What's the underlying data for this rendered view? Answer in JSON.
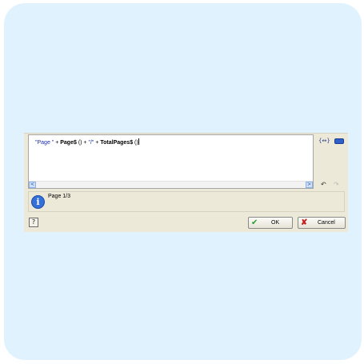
{
  "editor": {
    "expression": {
      "part1": "\"Page \"",
      "part2": " + ",
      "part3": "Page$",
      "part4": " () + ",
      "part5": "\"/\"",
      "part6": " + ",
      "part7": "TotalPages$",
      "part8": " ()"
    },
    "scroll_left": "<",
    "scroll_right": ">"
  },
  "side_icons": {
    "braces": "{↔}",
    "braces_icon": "braces-icon",
    "keyboard_icon": "keyboard-icon"
  },
  "history": {
    "undo": "↶",
    "redo": "↷"
  },
  "result": {
    "text": "Page 1/3",
    "icon": "i"
  },
  "footer": {
    "help": "?",
    "ok_label": "OK",
    "ok_icon": "✔",
    "cancel_label": "Cancel",
    "cancel_icon": "✘"
  },
  "colors": {
    "background": "#dff2fd",
    "dialog": "#ece9d8",
    "string_literal": "#1a2fa8"
  }
}
